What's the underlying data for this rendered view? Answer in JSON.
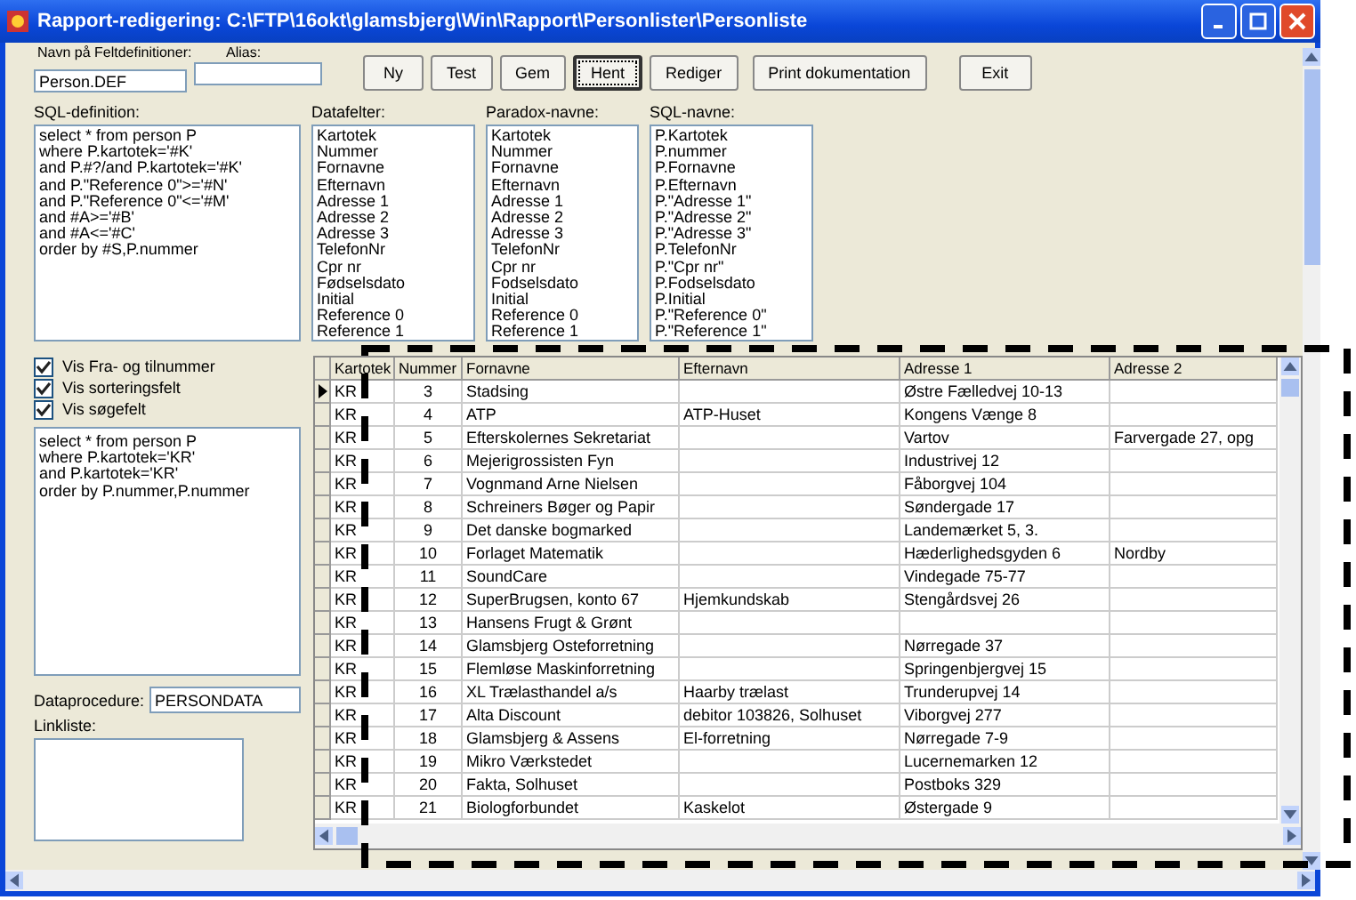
{
  "window": {
    "title": "Rapport-redigering: C:\\FTP\\16okt\\glamsbjerg\\Win\\Rapport\\Personlister\\Personliste"
  },
  "name_field": {
    "label": "Navn på Feltdefinitioner:",
    "value": "Person.DEF"
  },
  "alias_field": {
    "label": "Alias:"
  },
  "buttons": [
    {
      "label": "Ny",
      "focused": false
    },
    {
      "label": "Test",
      "focused": false
    },
    {
      "label": "Gem",
      "focused": false
    },
    {
      "label": "Hent",
      "focused": true
    },
    {
      "label": "Rediger",
      "focused": false
    },
    {
      "label": "Print dokumentation",
      "focused": false
    },
    {
      "label": "Exit",
      "focused": false
    }
  ],
  "lists": [
    {
      "label": "SQL-definition:",
      "items": [
        "select * from person P",
        "where P.kartotek='#K'",
        "and P.#?/and P.kartotek='#K'",
        "and P.\"Reference 0\">='#N'",
        "and P.\"Reference 0\"<='#M'",
        "and #A>='#B'",
        "and #A<='#C'",
        "order by #S,P.nummer"
      ]
    },
    {
      "label": "Datafelter:",
      "items": [
        "Kartotek",
        "Nummer",
        "Fornavne",
        "Efternavn",
        "Adresse 1",
        "Adresse 2",
        "Adresse 3",
        "TelefonNr",
        "Cpr nr",
        "Fødselsdato",
        "Initial",
        "Reference 0",
        "Reference 1"
      ]
    },
    {
      "label": "Paradox-navne:",
      "items": [
        "Kartotek",
        "Nummer",
        "Fornavne",
        "Efternavn",
        "Adresse 1",
        "Adresse 2",
        "Adresse 3",
        "TelefonNr",
        "Cpr nr",
        "Fodselsdato",
        "Initial",
        "Reference 0",
        "Reference 1"
      ]
    },
    {
      "label": "SQL-navne:",
      "items": [
        "P.Kartotek",
        "P.nummer",
        "P.Fornavne",
        "P.Efternavn",
        "P.\"Adresse 1\"",
        "P.\"Adresse 2\"",
        "P.\"Adresse 3\"",
        "P.TelefonNr",
        "P.\"Cpr nr\"",
        "P.Fodselsdato",
        "P.Initial",
        "P.\"Reference 0\"",
        "P.\"Reference 1\""
      ]
    }
  ],
  "checkboxes": [
    {
      "label": "Vis Fra- og tilnummer",
      "checked": true
    },
    {
      "label": "Vis sorteringsfelt",
      "checked": true
    },
    {
      "label": "Vis søgefelt",
      "checked": true
    }
  ],
  "result_sql": [
    "select * from person P",
    "where P.kartotek='KR'",
    "and P.kartotek='KR'",
    "order by P.nummer,P.nummer"
  ],
  "dataprocedure": {
    "label": "Dataprocedure:",
    "value": "PERSONDATA"
  },
  "linkliste": {
    "label": "Linkliste:"
  },
  "table": {
    "columns": [
      "Kartotek",
      "Nummer",
      "Fornavne",
      "Efternavn",
      "Adresse 1",
      "Adresse 2"
    ],
    "rows": [
      {
        "current": true,
        "cells": [
          "KR",
          "3",
          "Stadsing",
          "",
          "Østre Fælledvej 10-13",
          ""
        ]
      },
      {
        "current": false,
        "cells": [
          "KR",
          "4",
          "ATP",
          "ATP-Huset",
          "Kongens Vænge 8",
          ""
        ]
      },
      {
        "current": false,
        "cells": [
          "KR",
          "5",
          "Efterskolernes Sekretariat",
          "",
          "Vartov",
          "Farvergade 27, opg"
        ]
      },
      {
        "current": false,
        "cells": [
          "KR",
          "6",
          "Mejerigrossisten Fyn",
          "",
          "Industrivej 12",
          ""
        ]
      },
      {
        "current": false,
        "cells": [
          "KR",
          "7",
          "Vognmand Arne Nielsen",
          "",
          "Fåborgvej 104",
          ""
        ]
      },
      {
        "current": false,
        "cells": [
          "KR",
          "8",
          "Schreiners Bøger og Papir",
          "",
          "Søndergade 17",
          ""
        ]
      },
      {
        "current": false,
        "cells": [
          "KR",
          "9",
          "Det danske bogmarked",
          "",
          "Landemærket 5, 3.",
          ""
        ]
      },
      {
        "current": false,
        "cells": [
          "KR",
          "10",
          "Forlaget Matematik",
          "",
          "Hæderlighedsgyden 6",
          "Nordby"
        ]
      },
      {
        "current": false,
        "cells": [
          "KR",
          "11",
          "SoundCare",
          "",
          "Vindegade 75-77",
          ""
        ]
      },
      {
        "current": false,
        "cells": [
          "KR",
          "12",
          "SuperBrugsen, konto 67",
          "Hjemkundskab",
          "Stengårdsvej 26",
          ""
        ]
      },
      {
        "current": false,
        "cells": [
          "KR",
          "13",
          "Hansens Frugt & Grønt",
          "",
          "",
          ""
        ]
      },
      {
        "current": false,
        "cells": [
          "KR",
          "14",
          "Glamsbjerg Osteforretning",
          "",
          "Nørregade 37",
          ""
        ]
      },
      {
        "current": false,
        "cells": [
          "KR",
          "15",
          "Flemløse Maskinforretning",
          "",
          "Springenbjergvej 15",
          ""
        ]
      },
      {
        "current": false,
        "cells": [
          "KR",
          "16",
          "XL Trælasthandel a/s",
          "Haarby trælast",
          "Trunderupvej 14",
          ""
        ]
      },
      {
        "current": false,
        "cells": [
          "KR",
          "17",
          "Alta Discount",
          "debitor 103826, Solhuset",
          "Viborgvej 277",
          ""
        ]
      },
      {
        "current": false,
        "cells": [
          "KR",
          "18",
          "Glamsbjerg & Assens",
          "El-forretning",
          "Nørregade 7-9",
          ""
        ]
      },
      {
        "current": false,
        "cells": [
          "KR",
          "19",
          "Mikro Værkstedet",
          "",
          "Lucernemarken 12",
          ""
        ]
      },
      {
        "current": false,
        "cells": [
          "KR",
          "20",
          "Fakta, Solhuset",
          "",
          "Postboks 329",
          ""
        ]
      },
      {
        "current": false,
        "cells": [
          "KR",
          "21",
          "Biologforbundet",
          "Kaskelot",
          "Østergade 9",
          ""
        ]
      }
    ]
  }
}
